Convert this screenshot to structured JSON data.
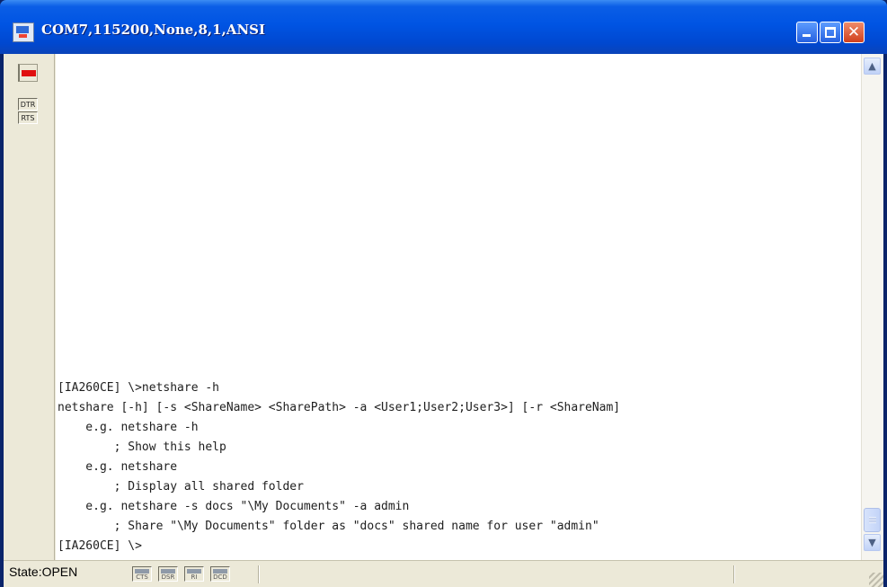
{
  "window": {
    "title": "COM7,115200,None,8,1,ANSI",
    "icon": "serial-terminal-app-icon",
    "controls": {
      "minimize": "minimize-icon",
      "maximize": "maximize-icon",
      "close": "close-icon",
      "close_glyph": "✕"
    }
  },
  "side_panel": {
    "led_color": "#e01010",
    "signals": [
      "DTR",
      "RTS"
    ]
  },
  "terminal": {
    "lines": [
      "[IA260CE] \\>netshare -h",
      "netshare [-h] [-s <ShareName> <SharePath> -a <User1;User2;User3>] [-r <ShareNam]",
      "    e.g. netshare -h",
      "        ; Show this help",
      "    e.g. netshare",
      "        ; Display all shared folder",
      "    e.g. netshare -s docs \"\\My Documents\" -a admin",
      "        ; Share \"\\My Documents\" folder as \"docs\" shared name for user \"admin\"",
      "[IA260CE] \\>"
    ]
  },
  "scrollbar": {
    "up": "▲",
    "down": "▼"
  },
  "status_bar": {
    "state": "State:OPEN",
    "indicators": [
      "CTS",
      "DSR",
      "RI",
      "DCD"
    ]
  }
}
